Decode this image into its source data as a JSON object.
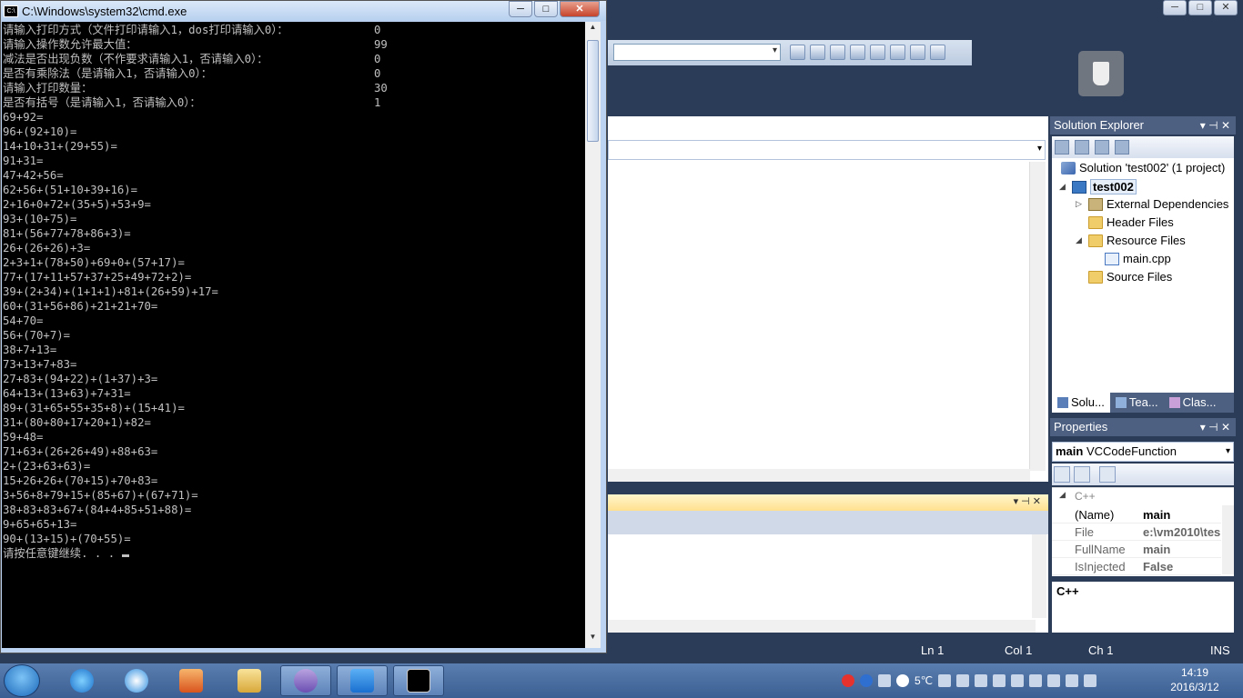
{
  "cmd": {
    "title": "C:\\Windows\\system32\\cmd.exe",
    "window_buttons": {
      "minimize": "─",
      "maximize": "□",
      "close": "✕"
    },
    "settings": [
      {
        "label": "请输入打印方式（文件打印请输入1，dos打印请输入0）：",
        "value": "0"
      },
      {
        "label": "请输入操作数允许最大值：",
        "value": "99"
      },
      {
        "label": "减法是否出现负数（不作要求请输入1，否请输入0）：",
        "value": "0"
      },
      {
        "label": "是否有乘除法（是请输入1，否请输入0）：",
        "value": "0"
      },
      {
        "label": "请输入打印数量：",
        "value": "30"
      },
      {
        "label": "是否有括号（是请输入1，否请输入0）：",
        "value": "1"
      }
    ],
    "expressions": [
      "69+92=",
      "96+(92+10)=",
      "14+10+31+(29+55)=",
      "91+31=",
      "47+42+56=",
      "62+56+(51+10+39+16)=",
      "2+16+0+72+(35+5)+53+9=",
      "93+(10+75)=",
      "81+(56+77+78+86+3)=",
      "26+(26+26)+3=",
      "2+3+1+(78+50)+69+0+(57+17)=",
      "77+(17+11+57+37+25+49+72+2)=",
      "39+(2+34)+(1+1+1)+81+(26+59)+17=",
      "60+(31+56+86)+21+21+70=",
      "54+70=",
      "56+(70+7)=",
      "38+7+13=",
      "73+13+7+83=",
      "27+83+(94+22)+(1+37)+3=",
      "64+13+(13+63)+7+31=",
      "89+(31+65+55+35+8)+(15+41)=",
      "31+(80+80+17+20+1)+82=",
      "59+48=",
      "71+63+(26+26+49)+88+63=",
      "2+(23+63+63)=",
      "15+26+26+(70+15)+70+83=",
      "3+56+8+79+15+(85+67)+(67+71)=",
      "38+83+83+67+(84+4+85+51+88)=",
      "9+65+65+13=",
      "90+(13+15)+(70+55)="
    ],
    "prompt": "请按任意键继续. . . "
  },
  "solution_explorer": {
    "title": "Solution Explorer",
    "solution": "Solution 'test002' (1 project)",
    "project": "test002",
    "items": [
      {
        "label": "External Dependencies",
        "kind": "deps",
        "expander": "▷"
      },
      {
        "label": "Header Files",
        "kind": "folder",
        "expander": ""
      },
      {
        "label": "Resource Files",
        "kind": "folder",
        "expander": "◢"
      },
      {
        "label": "main.cpp",
        "kind": "cpp",
        "expander": ""
      },
      {
        "label": "Source Files",
        "kind": "folder",
        "expander": ""
      }
    ],
    "tabs": [
      "Solu...",
      "Tea...",
      "Clas..."
    ]
  },
  "properties": {
    "title": "Properties",
    "object_name": "main",
    "object_type": "VCCodeFunction",
    "category": "C++",
    "rows": [
      {
        "name": "(Name)",
        "value": "main",
        "dim": false
      },
      {
        "name": "File",
        "value": "e:\\vm2010\\tes",
        "dim": true
      },
      {
        "name": "FullName",
        "value": "main",
        "dim": true
      },
      {
        "name": "IsInjected",
        "value": "False",
        "dim": true
      }
    ],
    "description": "C++"
  },
  "statusbar": {
    "ln": "Ln 1",
    "col": "Col 1",
    "ch": "Ch 1",
    "mode": "INS"
  },
  "taskbar": {
    "time": "14:19",
    "date": "2016/3/12",
    "temp": "5℃"
  },
  "icons": {
    "usb": "usb-drive-icon",
    "start": "windows-start-icon"
  }
}
